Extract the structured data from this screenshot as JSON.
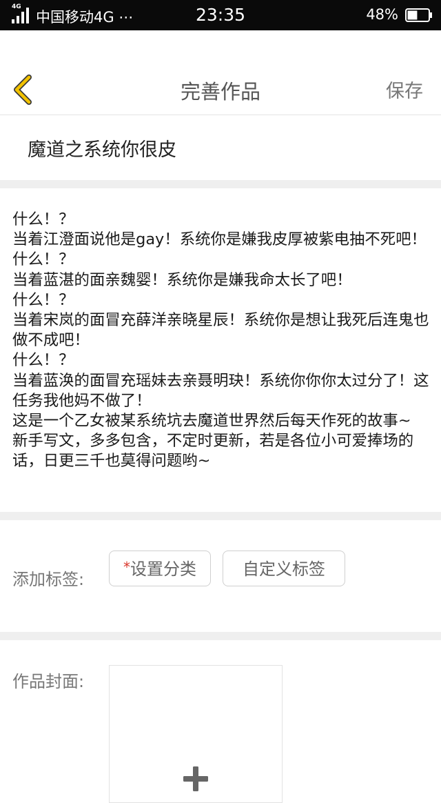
{
  "status_bar": {
    "network_tag": "4G",
    "carrier": "中国移动4G ⋯",
    "time": "23:35",
    "battery": "48%",
    "battery_level": 0.48
  },
  "nav": {
    "back_icon": "chevron-left-icon",
    "title": "完善作品",
    "save_label": "保存",
    "accent_color": "#f2c200"
  },
  "work": {
    "title": "魔道之系统你很皮"
  },
  "description": {
    "lines": [
      "什么！？",
      "当着江澄面说他是gay！系统你是嫌我皮厚被紫电抽不死吧！",
      "什么！？",
      "当着蓝湛的面亲魏婴！系统你是嫌我命太长了吧！",
      "什么！？",
      "当着宋岚的面冒充薛洋亲晓星辰！系统你是想让我死后连鬼也做不成吧！",
      "什么！？",
      "当着蓝涣的面冒充瑶妹去亲聂明玦！系统你你你太过分了！这任务我他妈不做了！",
      "这是一个乙女被某系统坑去魔道世界然后每天作死的故事~",
      "新手写文，多多包含，不定时更新，若是各位小可爱捧场的话，日更三千也莫得问题哟~"
    ]
  },
  "tags": {
    "label": "添加标签:",
    "required_mark": "*",
    "category_button": "设置分类",
    "custom_button": "自定义标签"
  },
  "cover": {
    "label": "作品封面:",
    "add_icon": "plus-icon"
  }
}
